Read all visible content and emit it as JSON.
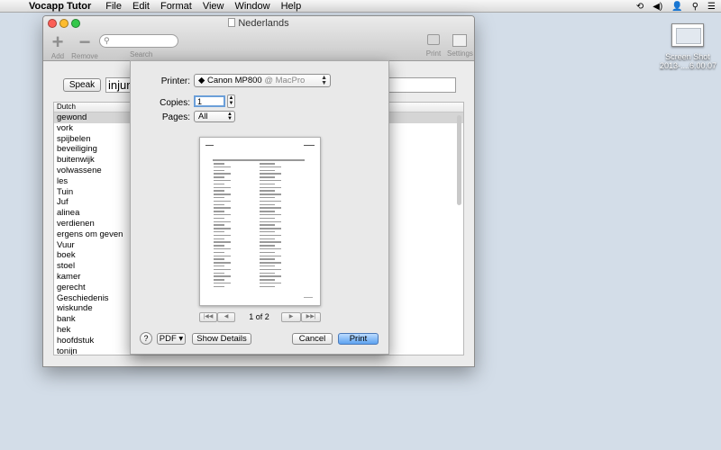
{
  "menubar": {
    "apple": "",
    "app_name": "Vocapp Tutor",
    "items": [
      "File",
      "Edit",
      "Format",
      "View",
      "Window",
      "Help"
    ],
    "status_icons": [
      "time-machine-icon",
      "volume-icon",
      "user-icon",
      "spotlight-icon",
      "notification-list-icon"
    ]
  },
  "desktop": {
    "screenshot_label_line1": "Screen Shot",
    "screenshot_label_line2": "2013-....6.00.07"
  },
  "window": {
    "title": "Nederlands",
    "toolbar": {
      "add_label": "Add",
      "remove_label": "Remove",
      "search_placeholder": "Search",
      "search_label": "Search",
      "print_label": "Print",
      "settings_label": "Settings"
    },
    "speak_label": "Speak",
    "word_value": "injur",
    "table": {
      "column": "Dutch",
      "rows": [
        "gewond",
        "vork",
        "spijbelen",
        "beveiliging",
        "buitenwijk",
        "volwassene",
        "les",
        "Tuin",
        "Juf",
        "alinea",
        "verdienen",
        "ergens om geven",
        "Vuur",
        "boek",
        "stoel",
        "kamer",
        "gerecht",
        "Geschiedenis",
        "wiskunde",
        "bank",
        "hek",
        "hoofdstuk",
        "tonijn"
      ]
    }
  },
  "print_sheet": {
    "printer_label": "Printer:",
    "printer_name": "Canon MP800",
    "printer_host": "@ MacPro",
    "copies_label": "Copies:",
    "copies_value": "1",
    "pages_label": "Pages:",
    "pages_value": "All",
    "page_indicator": "1 of 2",
    "help_label": "?",
    "pdf_label": "PDF ▾",
    "details_label": "Show Details",
    "cancel_label": "Cancel",
    "print_label": "Print"
  }
}
